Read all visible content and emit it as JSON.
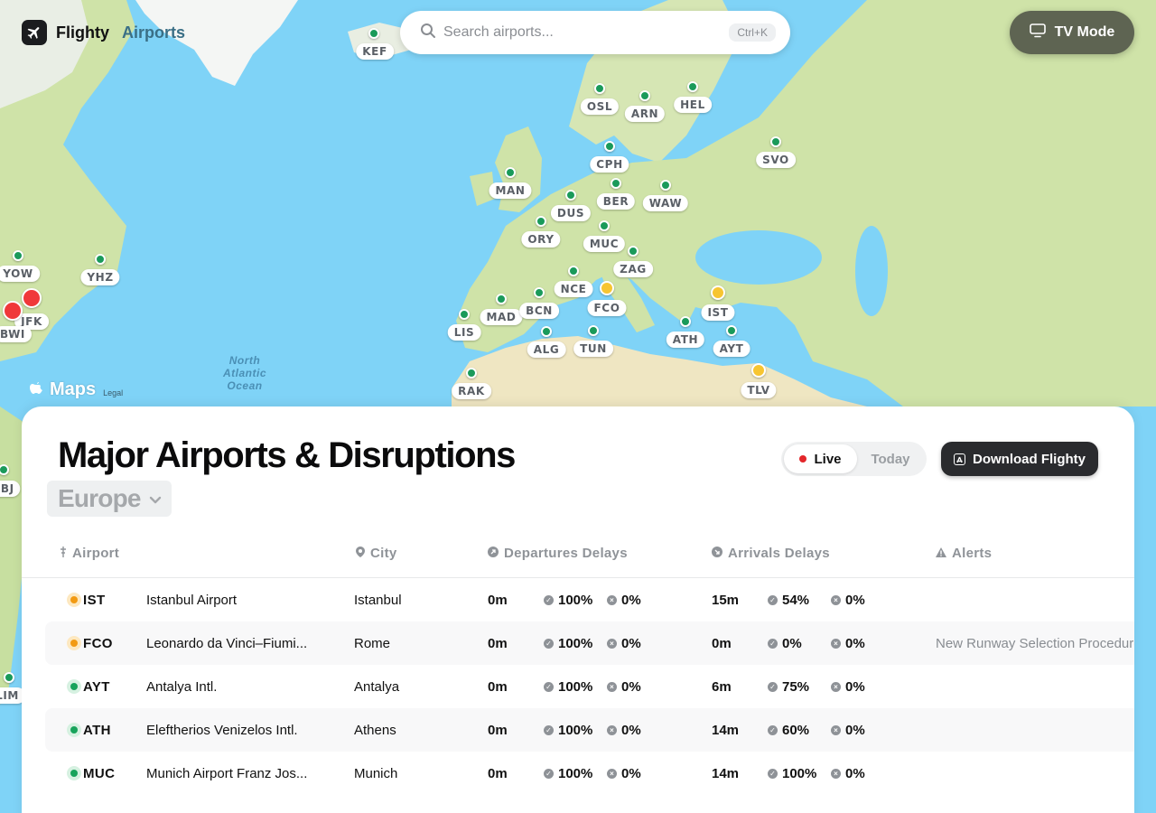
{
  "brand": {
    "name": "Flighty",
    "subtitle": "Airports"
  },
  "search": {
    "placeholder": "Search airports...",
    "shortcut": "Ctrl+K"
  },
  "tv_mode": {
    "label": "TV Mode"
  },
  "map": {
    "attribution": "Maps",
    "legal": "Legal",
    "ocean_label": [
      "North",
      "Atlantic",
      "Ocean"
    ],
    "airports": [
      {
        "code": "KEF",
        "status": "ok"
      },
      {
        "code": "OSL",
        "status": "ok"
      },
      {
        "code": "ARN",
        "status": "ok"
      },
      {
        "code": "HEL",
        "status": "ok"
      },
      {
        "code": "SVO",
        "status": "ok"
      },
      {
        "code": "CPH",
        "status": "ok"
      },
      {
        "code": "MAN",
        "status": "ok"
      },
      {
        "code": "DUS",
        "status": "ok"
      },
      {
        "code": "BER",
        "status": "ok"
      },
      {
        "code": "WAW",
        "status": "ok"
      },
      {
        "code": "ORY",
        "status": "ok"
      },
      {
        "code": "MUC",
        "status": "ok"
      },
      {
        "code": "ZAG",
        "status": "ok"
      },
      {
        "code": "NCE",
        "status": "ok"
      },
      {
        "code": "FCO",
        "status": "warn"
      },
      {
        "code": "IST",
        "status": "warn"
      },
      {
        "code": "MAD",
        "status": "ok"
      },
      {
        "code": "BCN",
        "status": "ok"
      },
      {
        "code": "LIS",
        "status": "ok"
      },
      {
        "code": "ALG",
        "status": "ok"
      },
      {
        "code": "TUN",
        "status": "ok"
      },
      {
        "code": "ATH",
        "status": "ok"
      },
      {
        "code": "AYT",
        "status": "ok"
      },
      {
        "code": "TLV",
        "status": "warn"
      },
      {
        "code": "RAK",
        "status": "ok"
      },
      {
        "code": "YOW",
        "status": "ok"
      },
      {
        "code": "YHZ",
        "status": "ok"
      },
      {
        "code": "JFK",
        "status": "bad"
      },
      {
        "code": "BWI",
        "status": "bad"
      },
      {
        "code": "MBJ",
        "status": "ok"
      },
      {
        "code": "LIM",
        "status": "ok"
      }
    ]
  },
  "panel": {
    "title": "Major Airports & Disruptions",
    "region": "Europe",
    "toggle": {
      "live": "Live",
      "today": "Today"
    },
    "download_label": "Download Flighty",
    "columns": {
      "airport": "Airport",
      "city": "City",
      "departures": "Departures Delays",
      "arrivals": "Arrivals Delays",
      "alerts": "Alerts"
    },
    "rows": [
      {
        "status": "warn",
        "code": "IST",
        "name": "Istanbul Airport",
        "city": "Istanbul",
        "dep_delay": "0m",
        "dep_ontime": "100%",
        "dep_cancel": "0%",
        "arr_delay": "15m",
        "arr_ontime": "54%",
        "arr_cancel": "0%",
        "alert": ""
      },
      {
        "status": "warn",
        "code": "FCO",
        "name": "Leonardo da Vinci–Fiumi...",
        "city": "Rome",
        "dep_delay": "0m",
        "dep_ontime": "100%",
        "dep_cancel": "0%",
        "arr_delay": "0m",
        "arr_ontime": "0%",
        "arr_cancel": "0%",
        "alert": "New Runway Selection Procedure"
      },
      {
        "status": "ok",
        "code": "AYT",
        "name": "Antalya Intl.",
        "city": "Antalya",
        "dep_delay": "0m",
        "dep_ontime": "100%",
        "dep_cancel": "0%",
        "arr_delay": "6m",
        "arr_ontime": "75%",
        "arr_cancel": "0%",
        "alert": ""
      },
      {
        "status": "ok",
        "code": "ATH",
        "name": "Eleftherios Venizelos Intl.",
        "city": "Athens",
        "dep_delay": "0m",
        "dep_ontime": "100%",
        "dep_cancel": "0%",
        "arr_delay": "14m",
        "arr_ontime": "60%",
        "arr_cancel": "0%",
        "alert": ""
      },
      {
        "status": "ok",
        "code": "MUC",
        "name": "Munich Airport Franz Jos...",
        "city": "Munich",
        "dep_delay": "0m",
        "dep_ontime": "100%",
        "dep_cancel": "0%",
        "arr_delay": "14m",
        "arr_ontime": "100%",
        "arr_cancel": "0%",
        "alert": ""
      }
    ]
  }
}
